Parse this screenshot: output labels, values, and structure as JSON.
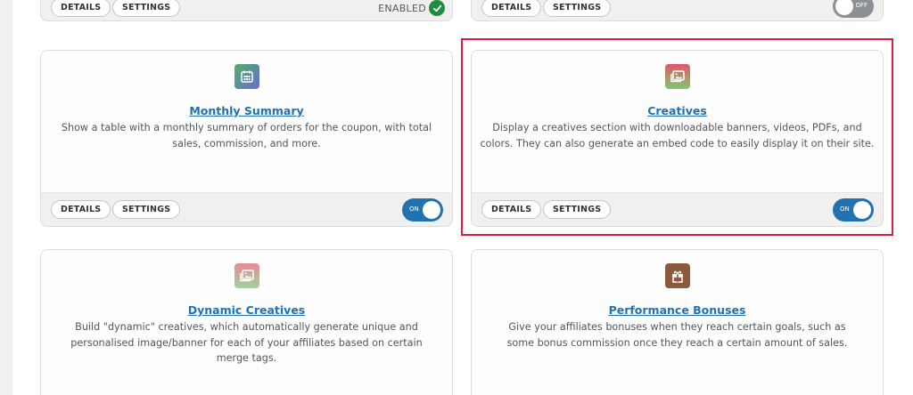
{
  "top_row": {
    "left": {
      "details_label": "DETAILS",
      "settings_label": "SETTINGS",
      "status_text": "ENABLED"
    },
    "right": {
      "details_label": "DETAILS",
      "settings_label": "SETTINGS",
      "toggle_label": "OFF"
    }
  },
  "cards": {
    "monthly_summary": {
      "title": "Monthly Summary",
      "description": "Show a table with a monthly summary of orders for the coupon, with total sales, commission, and more.",
      "details_label": "DETAILS",
      "settings_label": "SETTINGS",
      "toggle_label": "ON",
      "icon": "calendar-icon"
    },
    "creatives": {
      "title": "Creatives",
      "description": "Display a creatives section with downloadable banners, videos, PDFs, and colors. They can also generate an embed code to easily display it on their site.",
      "details_label": "DETAILS",
      "settings_label": "SETTINGS",
      "toggle_label": "ON",
      "icon": "image-gallery-icon"
    },
    "dynamic_creatives": {
      "title": "Dynamic Creatives",
      "description": "Build \"dynamic\" creatives, which automatically generate unique and personalised image/banner for each of your affiliates based on certain merge tags.",
      "icon": "image-gallery-icon"
    },
    "performance_bonuses": {
      "title": "Performance Bonuses",
      "description": "Give your affiliates bonuses when they reach certain goals, such as some bonus commission once they reach a certain amount of sales.",
      "icon": "gift-icon"
    }
  },
  "colors": {
    "accent": "#2271b1",
    "highlight": "#e11d3f",
    "enabled_check": "#1e8e3e"
  }
}
